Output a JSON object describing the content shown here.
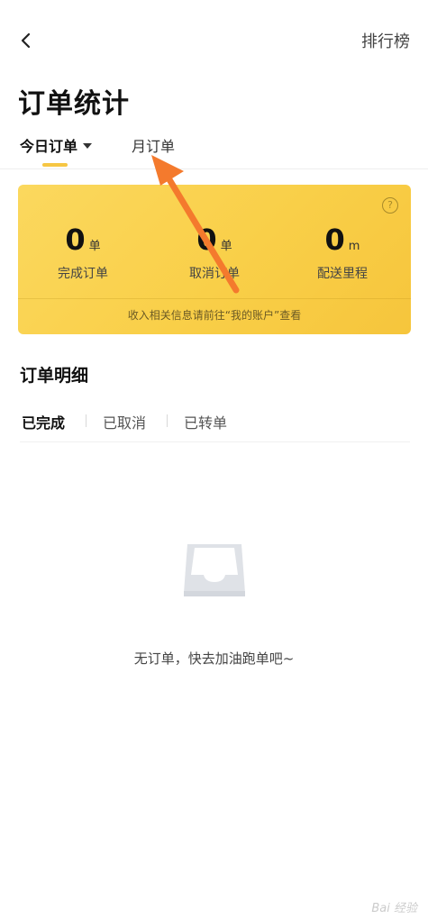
{
  "header": {
    "title": "订单统计",
    "ranking_label": "排行榜"
  },
  "period_tabs": {
    "today_label": "今日订单",
    "month_label": "月订单"
  },
  "stats": {
    "completed": {
      "value": "0",
      "unit": "单",
      "label": "完成订单"
    },
    "cancelled": {
      "value": "0",
      "unit": "单",
      "label": "取消订单"
    },
    "distance": {
      "value": "0",
      "unit": "m",
      "label": "配送里程"
    },
    "note": "收入相关信息请前往“我的账户”查看"
  },
  "details": {
    "title": "订单明细",
    "tabs": [
      "已完成",
      "已取消",
      "已转单"
    ],
    "active_tab": "已完成"
  },
  "empty_state": {
    "message": "无订单，快去加油跑单吧~"
  },
  "colors": {
    "accent": "#f6c643",
    "card": "#f9cf48",
    "annotation_arrow": "#f47a2d"
  },
  "icons": {
    "back": "chevron-left-icon",
    "help": "question-circle-icon",
    "empty": "empty-tray-icon"
  }
}
